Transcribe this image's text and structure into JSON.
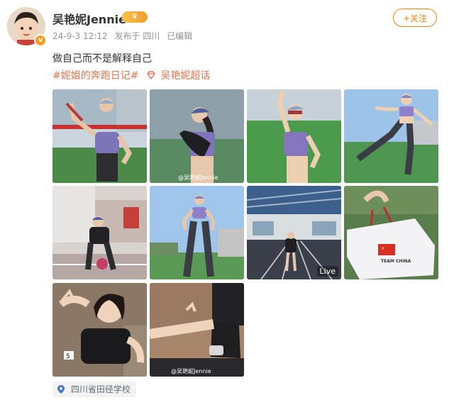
{
  "header": {
    "username": "吴艳妮Jennie",
    "vip_badge": "♛",
    "date": "24-9-3 12:12",
    "source": "发布于 四川",
    "edited": "已编辑",
    "follow_label": "+关注"
  },
  "post": {
    "text": "做自己而不是解释自己",
    "topic_1": "#妮姐的奔跑日记#",
    "topic_2": "吴艳妮超话"
  },
  "images": {
    "watermark": "@吴艳妮Jennie",
    "live_label": "Live",
    "team_label": "TEAM CHINA",
    "number_card": "5"
  },
  "location": {
    "label": "四川省田径学校"
  },
  "colors": {
    "accent": "#ff8200",
    "topic": "#eb7350",
    "meta": "#939393"
  }
}
